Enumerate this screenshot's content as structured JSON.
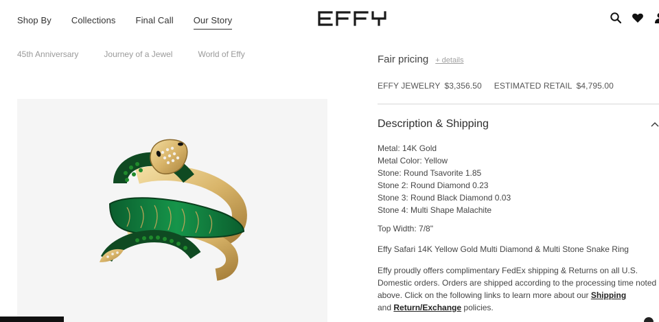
{
  "header": {
    "nav": [
      "Shop By",
      "Collections",
      "Final Call",
      "Our Story"
    ],
    "active_nav": "Our Story",
    "logo_text": "EFFY",
    "icons": [
      "search-icon",
      "heart-icon",
      "account-icon"
    ]
  },
  "subnav": {
    "links": [
      "45th Anniversary",
      "Journey of a Jewel",
      "World of Effy"
    ]
  },
  "product": {
    "image_alt": "Effy Safari 14K Yellow Gold Multi Diamond & Multi Stone Snake Ring",
    "colors": {
      "gold": "#d9b56a",
      "malachite": "#0f7a3c",
      "tsavorite": "#1f7a2a",
      "diamond": "#f3efe8"
    }
  },
  "pricing": {
    "fair_label": "Fair pricing",
    "details_link": "+ details",
    "effy_label": "EFFY JEWELRY",
    "effy_price": "$3,356.50",
    "retail_label": "ESTIMATED RETAIL",
    "retail_price": "$4,795.00"
  },
  "description": {
    "title": "Description & Shipping",
    "specs": [
      "Metal: 14K Gold",
      "Metal Color: Yellow",
      "Stone: Round Tsavorite 1.85",
      "Stone 2: Round Diamond 0.23",
      "Stone 3: Round Black Diamond 0.03",
      "Stone 4: Multi Shape Malachite"
    ],
    "top_width": "Top Width: 7/8\"",
    "product_name": "Effy Safari 14K Yellow Gold Multi Diamond & Multi Stone Snake Ring",
    "shipping_text_1": "Effy proudly offers complimentary FedEx shipping & Returns on all U.S. Domestic orders. Orders are shipped according to the processing time noted above. Click on the following links to learn more about our ",
    "shipping_link": "Shipping",
    "shipping_text_2": " and ",
    "returns_link": "Return/Exchange",
    "shipping_text_3": " policies."
  }
}
